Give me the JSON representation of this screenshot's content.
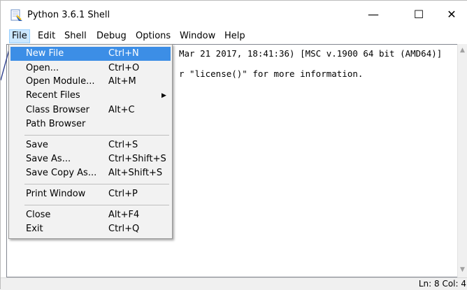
{
  "window": {
    "title": "Python 3.6.1 Shell",
    "controls": {
      "minimize": "—",
      "maximize": "☐",
      "close": "✕"
    }
  },
  "menubar": {
    "items": [
      "File",
      "Edit",
      "Shell",
      "Debug",
      "Options",
      "Window",
      "Help"
    ],
    "active": "File"
  },
  "editor": {
    "line1_visible": "Mar 21 2017, 18:41:36) [MSC v.1900 64 bit (AMD64)]",
    "line2_visible": "r \"license()\" for more information."
  },
  "file_menu": {
    "items": [
      {
        "label": "New File",
        "accel": "Ctrl+N",
        "highlighted": true
      },
      {
        "label": "Open...",
        "accel": "Ctrl+O"
      },
      {
        "label": "Open Module...",
        "accel": "Alt+M"
      },
      {
        "label": "Recent Files",
        "accel": "",
        "submenu": true
      },
      {
        "label": "Class Browser",
        "accel": "Alt+C"
      },
      {
        "label": "Path Browser",
        "accel": ""
      },
      {
        "label": "Save",
        "accel": "Ctrl+S"
      },
      {
        "label": "Save As...",
        "accel": "Ctrl+Shift+S"
      },
      {
        "label": "Save Copy As...",
        "accel": "Alt+Shift+S"
      },
      {
        "label": "Print Window",
        "accel": "Ctrl+P"
      },
      {
        "label": "Close",
        "accel": "Alt+F4"
      },
      {
        "label": "Exit",
        "accel": "Ctrl+Q"
      }
    ]
  },
  "statusbar": {
    "text": "Ln: 8  Col: 4"
  },
  "colors": {
    "highlight": "#3c8ee6",
    "menu_bg": "#f2f2f2",
    "active_menubar": "#cce8ff"
  }
}
